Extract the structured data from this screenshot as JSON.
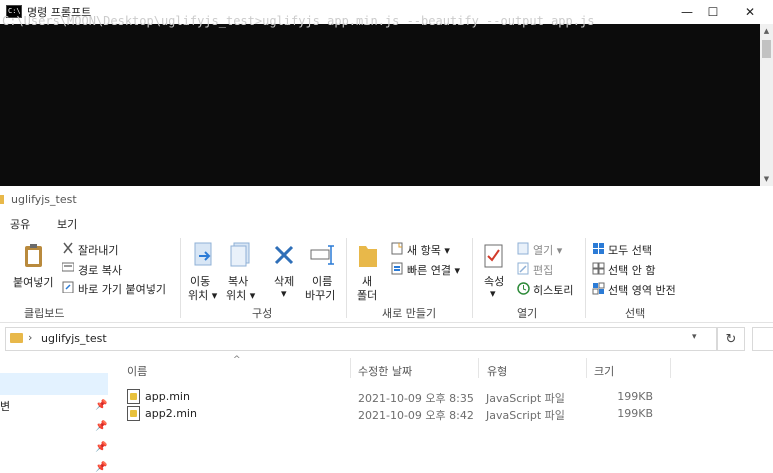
{
  "cmd": {
    "title": "명령 프롬프트",
    "icon_label": "C:\\",
    "prompt": "C:\\Users\\MOON\\Desktop\\uglifyjs_test>",
    "command": "uglifyjs app.min.js --beautify --output app.js",
    "controls": {
      "minimize": "—",
      "maximize": "☐",
      "close": "✕"
    }
  },
  "explorer": {
    "title": "uglifyjs_test",
    "tabs": [
      "공유",
      "보기"
    ],
    "ribbon": {
      "clipboard": {
        "pin_label": "붙여넣기",
        "cut": "잘라내기",
        "copy_path": "경로 복사",
        "paste_shortcut": "바로 가기 붙여넣기",
        "group": "클립보드"
      },
      "organize": {
        "move_to": [
          "이동",
          "위치 ▾"
        ],
        "copy_to": [
          "복사",
          "위치 ▾"
        ],
        "delete": [
          "삭제",
          "▾"
        ],
        "rename": [
          "이름",
          "바꾸기"
        ],
        "group": "구성"
      },
      "new": {
        "new_folder": [
          "새",
          "폴더"
        ],
        "new_item": "새 항목 ▾",
        "easy_access": "빠른 연결 ▾",
        "group": "새로 만들기"
      },
      "open": {
        "properties": [
          "속성",
          "▾"
        ],
        "open": "열기 ▾",
        "edit": "편집",
        "history": "히스토리",
        "group": "열기"
      },
      "select": {
        "select_all": "모두 선택",
        "select_none": "선택 안 함",
        "invert": "선택 영역 반전",
        "group": "선택"
      }
    },
    "address": {
      "path": "uglifyjs_test"
    },
    "columns": {
      "name": "이름",
      "date": "수정한 날짜",
      "type": "유형",
      "size": "크기"
    },
    "nav_fragment": "변",
    "files": [
      {
        "name": "app.min",
        "date": "2021-10-09 오후 8:35",
        "type": "JavaScript 파일",
        "size": "199KB"
      },
      {
        "name": "app2.min",
        "date": "2021-10-09 오후 8:42",
        "type": "JavaScript 파일",
        "size": "199KB"
      }
    ]
  },
  "colors": {
    "cmd_bg": "#0c0c0c",
    "cmd_text": "#cccccc",
    "selection": "#cce8ff",
    "folder": "#e8b84a",
    "accent_blue": "#2b7bd6"
  }
}
